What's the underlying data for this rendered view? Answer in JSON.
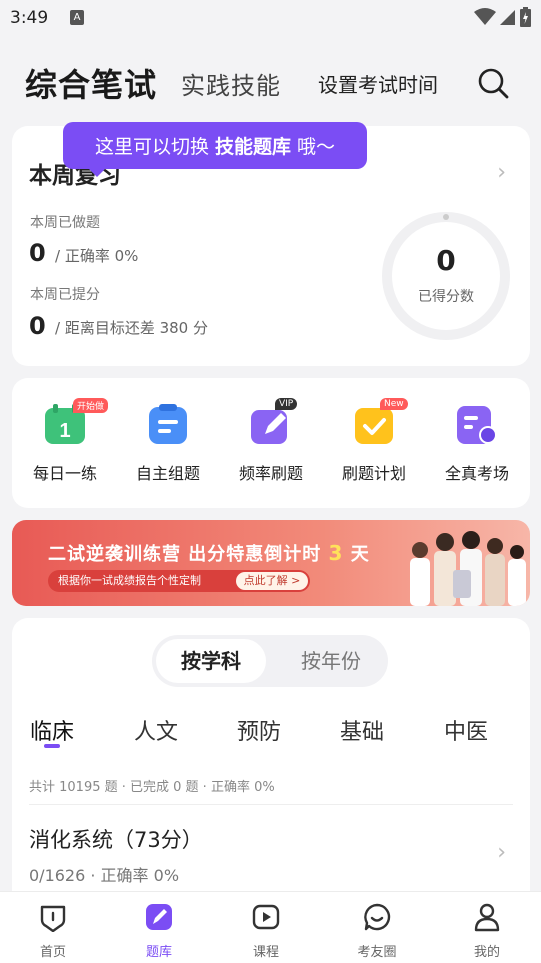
{
  "status_bar": {
    "time": "3:49",
    "notification_icon": "A"
  },
  "top_nav": {
    "active_tab": "综合笔试",
    "other_tab": "实践技能",
    "set_time": "设置考试时间"
  },
  "tooltip": {
    "prefix": "这里可以切换",
    "highlight": "技能题库",
    "suffix": "哦～"
  },
  "weekly_review": {
    "title": "本周复习",
    "done_label": "本周已做题",
    "done_value": "0",
    "accuracy": "/ 正确率 0%",
    "raised_label": "本周已提分",
    "raised_value": "0",
    "gap": "/ 距离目标还差 380 分",
    "score": "0",
    "score_label": "已得分数"
  },
  "tools": [
    {
      "name": "每日一练",
      "tag": "开始做",
      "icon": "calendar-icon"
    },
    {
      "name": "自主组题",
      "tag": "",
      "icon": "clipboard-icon"
    },
    {
      "name": "频率刷题",
      "tag": "VIP",
      "icon": "pencil-icon"
    },
    {
      "name": "刷题计划",
      "tag": "New",
      "icon": "check-icon"
    },
    {
      "name": "全真考场",
      "tag": "",
      "icon": "exam-icon"
    }
  ],
  "banner": {
    "headline_prefix": "二试逆袭训练营 出分特惠倒计时",
    "headline_num": "3",
    "headline_suffix": "天",
    "subline": "根据你一试成绩报告个性定制",
    "button": "点此了解 >"
  },
  "subjects": {
    "segment_on": "按学科",
    "segment_off": "按年份",
    "tabs": [
      "临床",
      "人文",
      "预防",
      "基础",
      "中医"
    ],
    "stats": "共计 10195 题 · 已完成 0 题 · 正确率 0%",
    "item_title": "消化系统（73分）",
    "item_sub": "0/1626 · 正确率 0%"
  },
  "tab_bar": [
    {
      "label": "首页",
      "icon": "home-icon"
    },
    {
      "label": "题库",
      "icon": "question-bank-icon"
    },
    {
      "label": "课程",
      "icon": "play-icon"
    },
    {
      "label": "考友圈",
      "icon": "chat-icon"
    },
    {
      "label": "我的",
      "icon": "person-icon"
    }
  ],
  "colors": {
    "accent": "#7b4df4",
    "banner": "#e85a55"
  }
}
